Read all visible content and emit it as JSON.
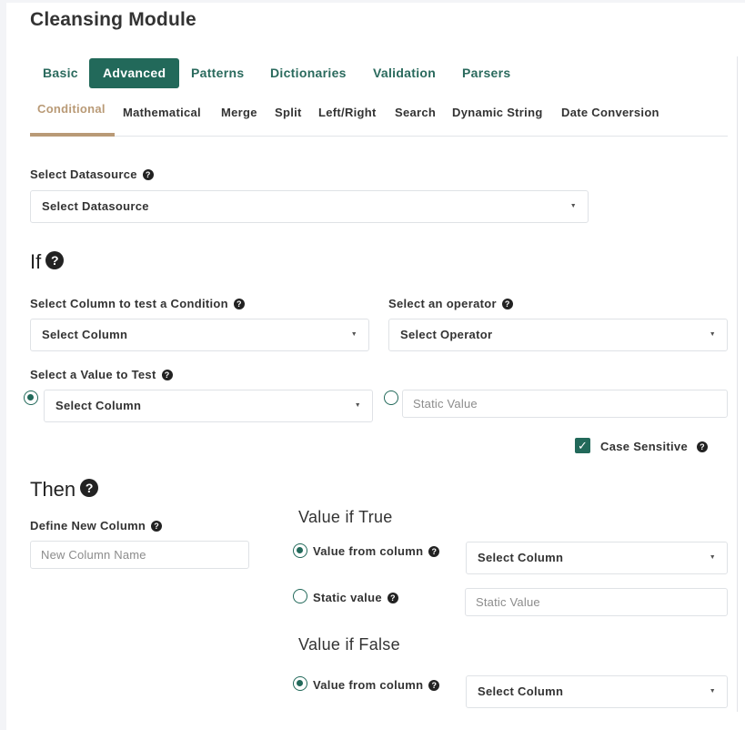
{
  "title": "Cleansing Module",
  "colors": {
    "accent": "#22695a",
    "active_subtab": "#b99a76"
  },
  "main_tabs": [
    {
      "label": "Basic"
    },
    {
      "label": "Advanced",
      "active": true
    },
    {
      "label": "Patterns"
    },
    {
      "label": "Dictionaries"
    },
    {
      "label": "Validation"
    },
    {
      "label": "Parsers"
    }
  ],
  "sub_tabs": [
    {
      "label": "Conditional",
      "active": true
    },
    {
      "label": "Mathematical"
    },
    {
      "label": "Merge"
    },
    {
      "label": "Split"
    },
    {
      "label": "Left/Right"
    },
    {
      "label": "Search"
    },
    {
      "label": "Dynamic String"
    },
    {
      "label": "Date Conversion"
    }
  ],
  "datasource": {
    "label": "Select Datasource",
    "value": "Select Datasource"
  },
  "if_section": {
    "heading": "If",
    "column_label": "Select Column to test a Condition",
    "column_value": "Select Column",
    "operator_label": "Select an operator",
    "operator_value": "Select Operator",
    "value_label": "Select a Value to Test",
    "value_column": "Select Column",
    "static_placeholder": "Static Value",
    "case_sensitive_label": "Case Sensitive",
    "case_sensitive_checked": true
  },
  "then_section": {
    "heading": "Then",
    "new_column_label": "Define New Column",
    "new_column_placeholder": "New Column Name",
    "if_true": {
      "heading": "Value if True",
      "from_column_label": "Value from column",
      "from_column_value": "Select Column",
      "static_label": "Static value",
      "static_placeholder": "Static Value"
    },
    "if_false": {
      "heading": "Value if False",
      "from_column_label": "Value from column",
      "from_column_value": "Select Column"
    }
  },
  "icons": {
    "help": "question-circle-icon",
    "caret": "caret-down-icon",
    "check": "check-icon"
  }
}
